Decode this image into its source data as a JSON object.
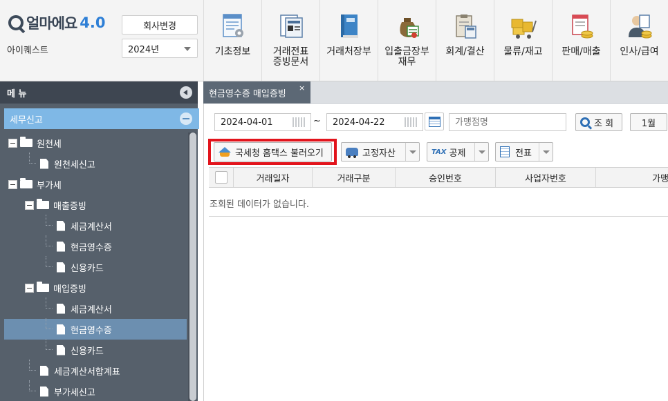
{
  "app": {
    "brand": "얼마에요",
    "version": "4.0",
    "company": "아이퀘스트",
    "change_company": "회사변경",
    "year": "2024년"
  },
  "menu": [
    {
      "label": "기초정보",
      "icon": "settings-form-icon"
    },
    {
      "label": "거래전표\n증빙문서",
      "icon": "voucher-icon"
    },
    {
      "label": "거래처장부",
      "icon": "ledger-book-icon"
    },
    {
      "label": "입출금장부\n재무",
      "icon": "money-bag-icon"
    },
    {
      "label": "회계/결산",
      "icon": "clipboard-calculator-icon"
    },
    {
      "label": "물류/재고",
      "icon": "cart-boxes-icon"
    },
    {
      "label": "판매/매출",
      "icon": "sales-coins-icon"
    },
    {
      "label": "인사/급여",
      "icon": "person-coins-icon"
    }
  ],
  "sidebar": {
    "title": "메 뉴",
    "section": "세무신고",
    "tree": [
      {
        "label": "원천세",
        "type": "folder",
        "level": 0
      },
      {
        "label": "원천세신고",
        "type": "file",
        "level": 1
      },
      {
        "label": "부가세",
        "type": "folder",
        "level": 0
      },
      {
        "label": "매출증빙",
        "type": "folder",
        "level": 1
      },
      {
        "label": "세금계산서",
        "type": "file",
        "level": 2
      },
      {
        "label": "현금영수증",
        "type": "file",
        "level": 2
      },
      {
        "label": "신용카드",
        "type": "file",
        "level": 2
      },
      {
        "label": "매입증빙",
        "type": "folder",
        "level": 1
      },
      {
        "label": "세금계산서",
        "type": "file",
        "level": 2
      },
      {
        "label": "현금영수증",
        "type": "file",
        "level": 2,
        "selected": true
      },
      {
        "label": "신용카드",
        "type": "file",
        "level": 2
      },
      {
        "label": "세금계산서합계표",
        "type": "file",
        "level": 1
      },
      {
        "label": "부가세신고",
        "type": "file",
        "level": 1
      }
    ]
  },
  "tab": {
    "label": "현금영수증 매입증빙",
    "close": "×"
  },
  "filters": {
    "date_from": "2024-04-01",
    "tilde": "~",
    "date_to": "2024-04-22",
    "store_placeholder": "가맹점명",
    "search": "조 회",
    "month": "1월"
  },
  "toolbar": {
    "hometax": "국세청 홈택스 불러오기",
    "fixed_asset": "고정자산",
    "tax_icon": "TAX",
    "deduction": "공제",
    "slip": "전표"
  },
  "grid": {
    "columns": [
      "거래일자",
      "거래구분",
      "승인번호",
      "사업자번호",
      "가맹"
    ],
    "empty_message": "조회된 데이터가 없습니다."
  },
  "colors": {
    "highlight": "#e2141c",
    "section": "#7fb8e6",
    "sidebar": "#56606b",
    "tab_active": "#5c6875"
  }
}
